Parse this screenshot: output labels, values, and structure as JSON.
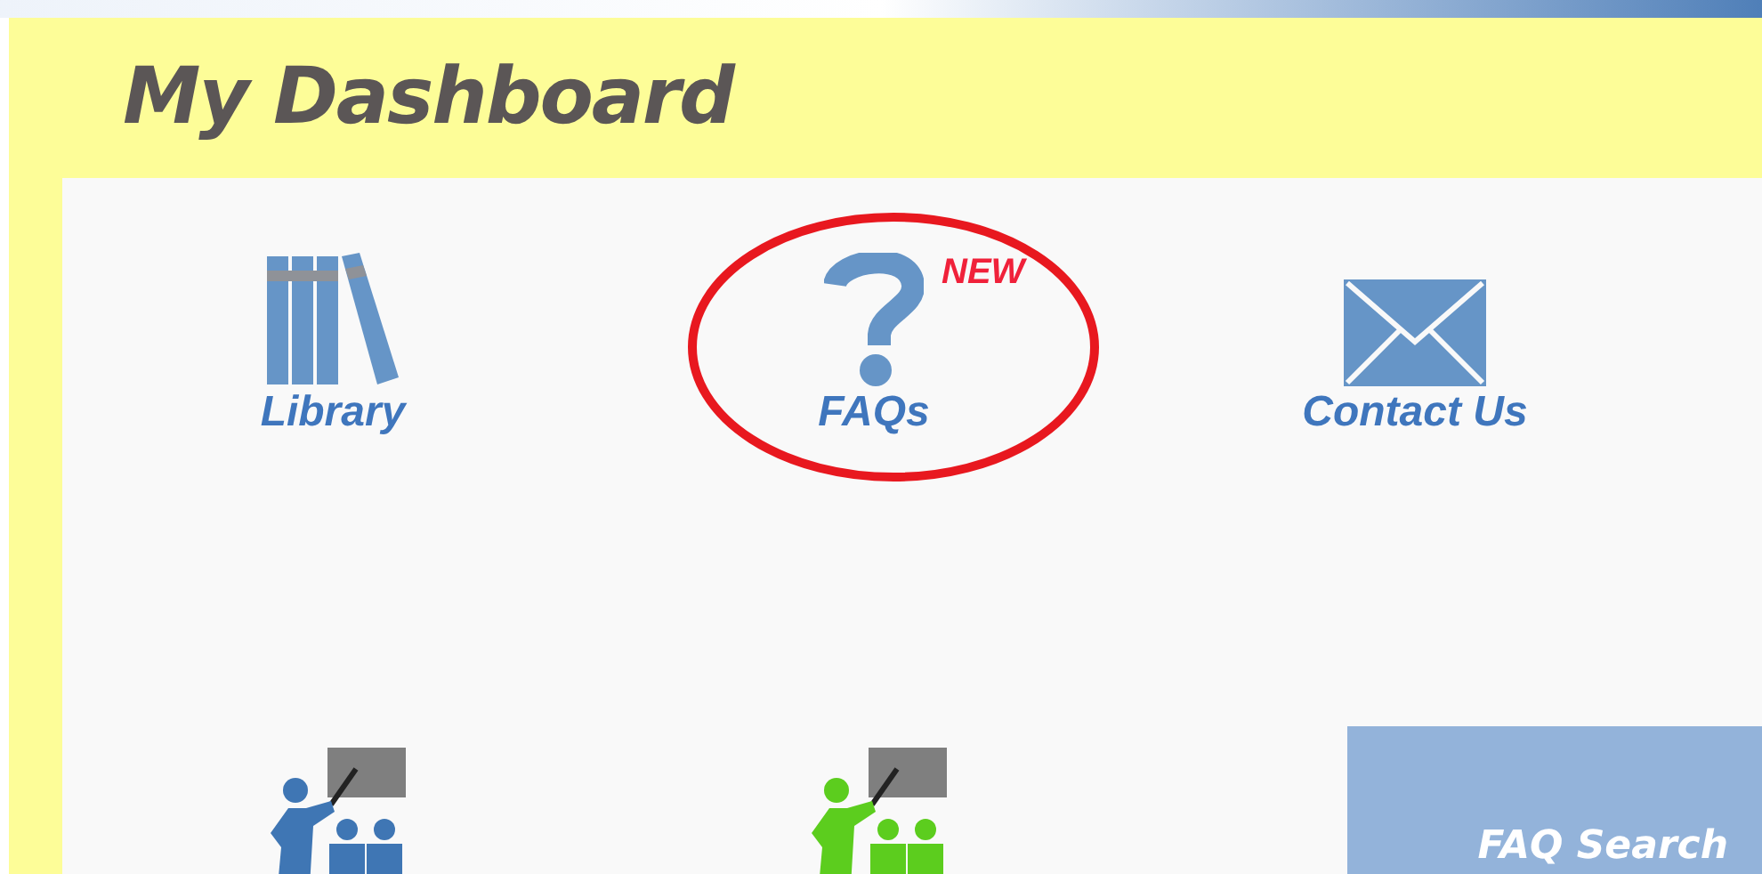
{
  "header": {
    "title": "My Dashboard"
  },
  "tiles": [
    {
      "kind": "library",
      "label": "Library",
      "highlighted": false
    },
    {
      "kind": "faq",
      "label": "FAQs",
      "badge": "NEW",
      "highlighted": true
    },
    {
      "kind": "contact",
      "label": "Contact Us",
      "highlighted": false
    }
  ],
  "training_tiles": [
    {
      "kind": "presenter",
      "color": "#3f76b4"
    },
    {
      "kind": "presenter",
      "color": "#5ccd1e"
    }
  ],
  "popup": {
    "label": "FAQ Search"
  }
}
